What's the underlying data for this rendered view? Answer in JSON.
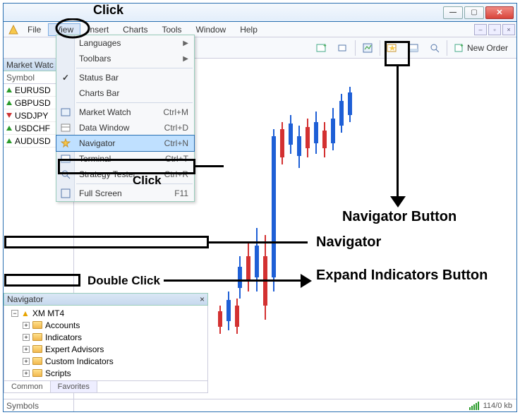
{
  "window": {
    "title": ""
  },
  "menubar": {
    "items": [
      "File",
      "View",
      "Insert",
      "Charts",
      "Tools",
      "Window",
      "Help"
    ],
    "open_index": 1
  },
  "toolbar": {
    "new_order_label": "New Order"
  },
  "market_watch": {
    "title": "Market Watc",
    "col": "Symbol",
    "rows": [
      {
        "dir": "up",
        "sym": "EURUSD"
      },
      {
        "dir": "up",
        "sym": "GBPUSD"
      },
      {
        "dir": "dn",
        "sym": "USDJPY"
      },
      {
        "dir": "up",
        "sym": "USDCHF"
      },
      {
        "dir": "up",
        "sym": "AUDUSD"
      }
    ],
    "footer": "Symbols"
  },
  "view_menu": {
    "items": [
      {
        "type": "sub",
        "label": "Languages"
      },
      {
        "type": "sub",
        "label": "Toolbars"
      },
      {
        "type": "sep"
      },
      {
        "type": "check",
        "label": "Status Bar",
        "checked": true
      },
      {
        "type": "item",
        "label": "Charts Bar"
      },
      {
        "type": "sep"
      },
      {
        "type": "cmd",
        "icon": "mw",
        "label": "Market Watch",
        "shortcut": "Ctrl+M"
      },
      {
        "type": "cmd",
        "icon": "dw",
        "label": "Data Window",
        "shortcut": "Ctrl+D"
      },
      {
        "type": "cmd",
        "icon": "nav",
        "label": "Navigator",
        "shortcut": "Ctrl+N",
        "highlight": true
      },
      {
        "type": "cmd",
        "icon": "term",
        "label": "Terminal",
        "shortcut": "Ctrl+T"
      },
      {
        "type": "cmd",
        "icon": "test",
        "label": "Strategy Tester",
        "shortcut": "Ctrl+R"
      },
      {
        "type": "sep"
      },
      {
        "type": "cmd",
        "icon": "fs",
        "label": "Full Screen",
        "shortcut": "F11"
      }
    ]
  },
  "navigator": {
    "title": "Navigator",
    "root": "XM MT4",
    "children": [
      "Accounts",
      "Indicators",
      "Expert Advisors",
      "Custom Indicators",
      "Scripts"
    ],
    "tabs": [
      "Common",
      "Favorites"
    ],
    "active_tab": 0
  },
  "status": {
    "rate": "114/0 kb"
  },
  "annotations": {
    "click_top": "Click",
    "click_mid": "Click",
    "dbl": "Double Click",
    "nav_btn": "Navigator Button",
    "nav": "Navigator",
    "expand": "Expand Indicators Button"
  }
}
